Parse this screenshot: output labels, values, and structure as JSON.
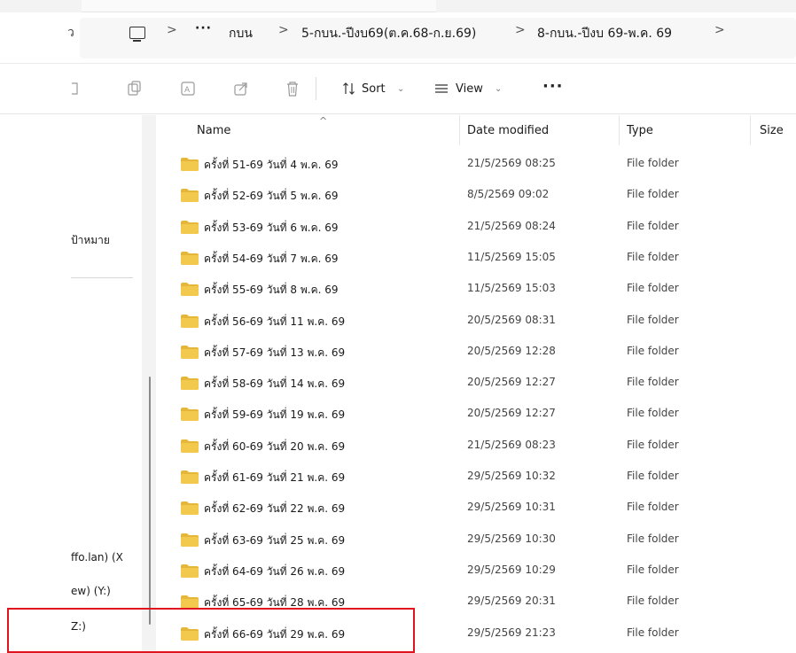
{
  "address": {
    "refresh_glyph": "ว",
    "ellipsis": "···",
    "crumbs": [
      "กบน",
      "5-กบน.-ปีงบ69(ต.ค.68-ก.ย.69)",
      "8-กบน.-ปีงบ 69-พ.ค. 69"
    ],
    "separator": ">"
  },
  "toolbar": {
    "sort_label": "Sort",
    "view_label": "View",
    "more_label": "···",
    "caret": "⌄"
  },
  "nav": {
    "items": [
      "ป้าหมาย",
      "ffo.lan) (X",
      "ew) (Y:)",
      "Z:)"
    ]
  },
  "columns": {
    "name": "Name",
    "date": "Date modified",
    "type": "Type",
    "size": "Size",
    "sort_caret": "^"
  },
  "rows": [
    {
      "name": "ครั้งที่ 51-69 วันที่  4 พ.ค. 69",
      "date": "21/5/2569 08:25",
      "type": "File folder"
    },
    {
      "name": "ครั้งที่ 52-69 วันที่ 5 พ.ค. 69",
      "date": "8/5/2569 09:02",
      "type": "File folder"
    },
    {
      "name": "ครั้งที่ 53-69 วันที่ 6 พ.ค. 69",
      "date": "21/5/2569 08:24",
      "type": "File folder"
    },
    {
      "name": "ครั้งที่ 54-69 วันที่ 7 พ.ค. 69",
      "date": "11/5/2569 15:05",
      "type": "File folder"
    },
    {
      "name": "ครั้งที่ 55-69 วันที่ 8 พ.ค. 69",
      "date": "11/5/2569 15:03",
      "type": "File folder"
    },
    {
      "name": "ครั้งที่ 56-69 วันที่ 11 พ.ค. 69",
      "date": "20/5/2569 08:31",
      "type": "File folder"
    },
    {
      "name": "ครั้งที่ 57-69 วันที่ 13 พ.ค. 69",
      "date": "20/5/2569 12:28",
      "type": "File folder"
    },
    {
      "name": "ครั้งที่ 58-69 วันที่ 14 พ.ค. 69",
      "date": "20/5/2569 12:27",
      "type": "File folder"
    },
    {
      "name": "ครั้งที่ 59-69 วันที่ 19 พ.ค. 69",
      "date": "20/5/2569 12:27",
      "type": "File folder"
    },
    {
      "name": "ครั้งที่ 60-69 วันที่ 20 พ.ค. 69",
      "date": "21/5/2569 08:23",
      "type": "File folder"
    },
    {
      "name": "ครั้งที่ 61-69 วันที่ 21 พ.ค. 69",
      "date": "29/5/2569 10:32",
      "type": "File folder"
    },
    {
      "name": "ครั้งที่ 62-69 วันที่ 22 พ.ค. 69",
      "date": "29/5/2569 10:31",
      "type": "File folder"
    },
    {
      "name": "ครั้งที่ 63-69 วันที่ 25 พ.ค. 69",
      "date": "29/5/2569 10:30",
      "type": "File folder"
    },
    {
      "name": "ครั้งที่ 64-69 วันที่ 26 พ.ค. 69",
      "date": "29/5/2569 10:29",
      "type": "File folder"
    },
    {
      "name": "ครั้งที่ 65-69 วันที่ 28 พ.ค. 69",
      "date": "29/5/2569 20:31",
      "type": "File folder"
    },
    {
      "name": "ครั้งที่ 66-69 วันที่ 29 พ.ค. 69",
      "date": "29/5/2569 21:23",
      "type": "File folder"
    }
  ],
  "colors": {
    "folder": "#f2c94c",
    "folder_tab": "#e4b63a",
    "highlight_border": "#e0141e"
  }
}
